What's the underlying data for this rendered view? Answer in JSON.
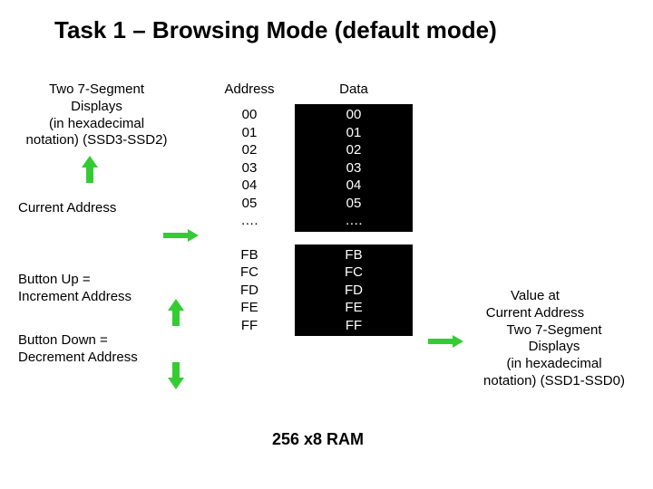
{
  "title": "Task 1 – Browsing Mode (default mode)",
  "left": {
    "seg_displays_l1": "Two 7-Segment",
    "seg_displays_l2": "Displays",
    "seg_displays_l3": "(in hexadecimal",
    "seg_displays_l4": "notation) (SSD3-SSD2)",
    "current_address": "Current Address",
    "btn_up_l1": "Button Up =",
    "btn_up_l2": " Increment Address",
    "btn_down_l1": "Button Down =",
    "btn_down_l2": " Decrement Address"
  },
  "table": {
    "addr_header": "Address",
    "data_header": "Data",
    "rows_top_addr": [
      "00",
      "01",
      "02",
      "03",
      "04",
      "05",
      "…."
    ],
    "rows_top_data": [
      "00",
      "01",
      "02",
      "03",
      "04",
      "05",
      "…."
    ],
    "rows_bot_addr": [
      "FB",
      "FC",
      "FD",
      "FE",
      "FF"
    ],
    "rows_bot_data": [
      "FB",
      "FC",
      "FD",
      "FE",
      "FF"
    ]
  },
  "ram_label": "256 x8 RAM",
  "right": {
    "l1": "Value at",
    "l2": "Current Address",
    "l3": "Two 7-Segment",
    "l4": "Displays",
    "l5": "(in hexadecimal",
    "l6": "notation) (SSD1-SSD0)"
  }
}
